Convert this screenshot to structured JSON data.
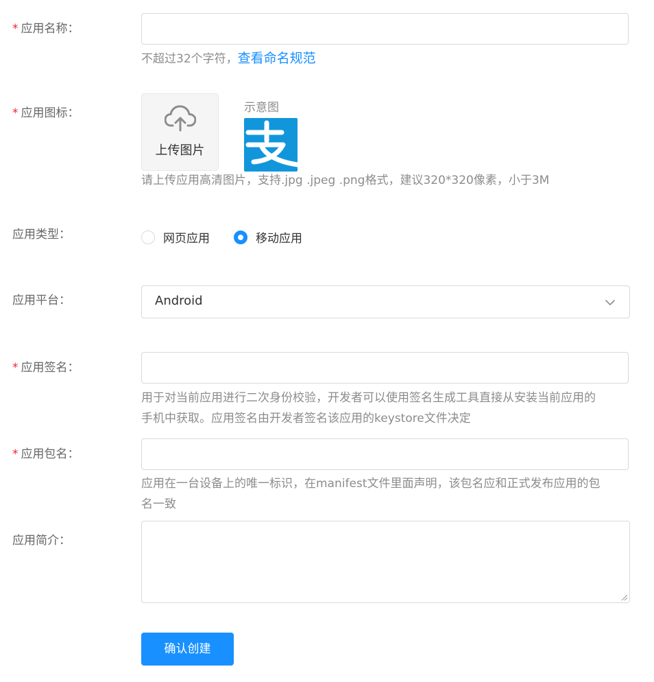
{
  "form": {
    "app_name": {
      "label": "应用名称：",
      "required_mark": "*",
      "value": "",
      "hint_text": "不超过32个字符，",
      "hint_link": "查看命名规范"
    },
    "app_icon": {
      "label": "应用图标：",
      "required_mark": "*",
      "upload_label": "上传图片",
      "sample_label": "示意图",
      "sample_icon": "alipay-logo",
      "hint_text": "请上传应用高清图片，支持.jpg .jpeg .png格式，建议320*320像素，小于3M"
    },
    "app_type": {
      "label": "应用类型：",
      "options": [
        {
          "label": "网页应用",
          "checked": false
        },
        {
          "label": "移动应用",
          "checked": true
        }
      ]
    },
    "app_platform": {
      "label": "应用平台：",
      "selected": "Android"
    },
    "app_signature": {
      "label": "应用签名：",
      "required_mark": "*",
      "value": "",
      "hint_line1": "用于对当前应用进行二次身份校验，开发者可以使用签名生成工具直接从安装当前应用的",
      "hint_line2": "手机中获取。应用签名由开发者签名该应用的keystore文件决定"
    },
    "app_package": {
      "label": "应用包名：",
      "required_mark": "*",
      "value": "",
      "hint_line1": "应用在一台设备上的唯一标识，在manifest文件里面声明，该包名应和正式发布应用的包",
      "hint_line2": "名一致"
    },
    "app_description": {
      "label": "应用简介：",
      "value": ""
    },
    "submit_label": "确认创建"
  },
  "colors": {
    "primary": "#1890ff",
    "required": "#f5222d",
    "sample_icon_bg": "#1296db"
  }
}
